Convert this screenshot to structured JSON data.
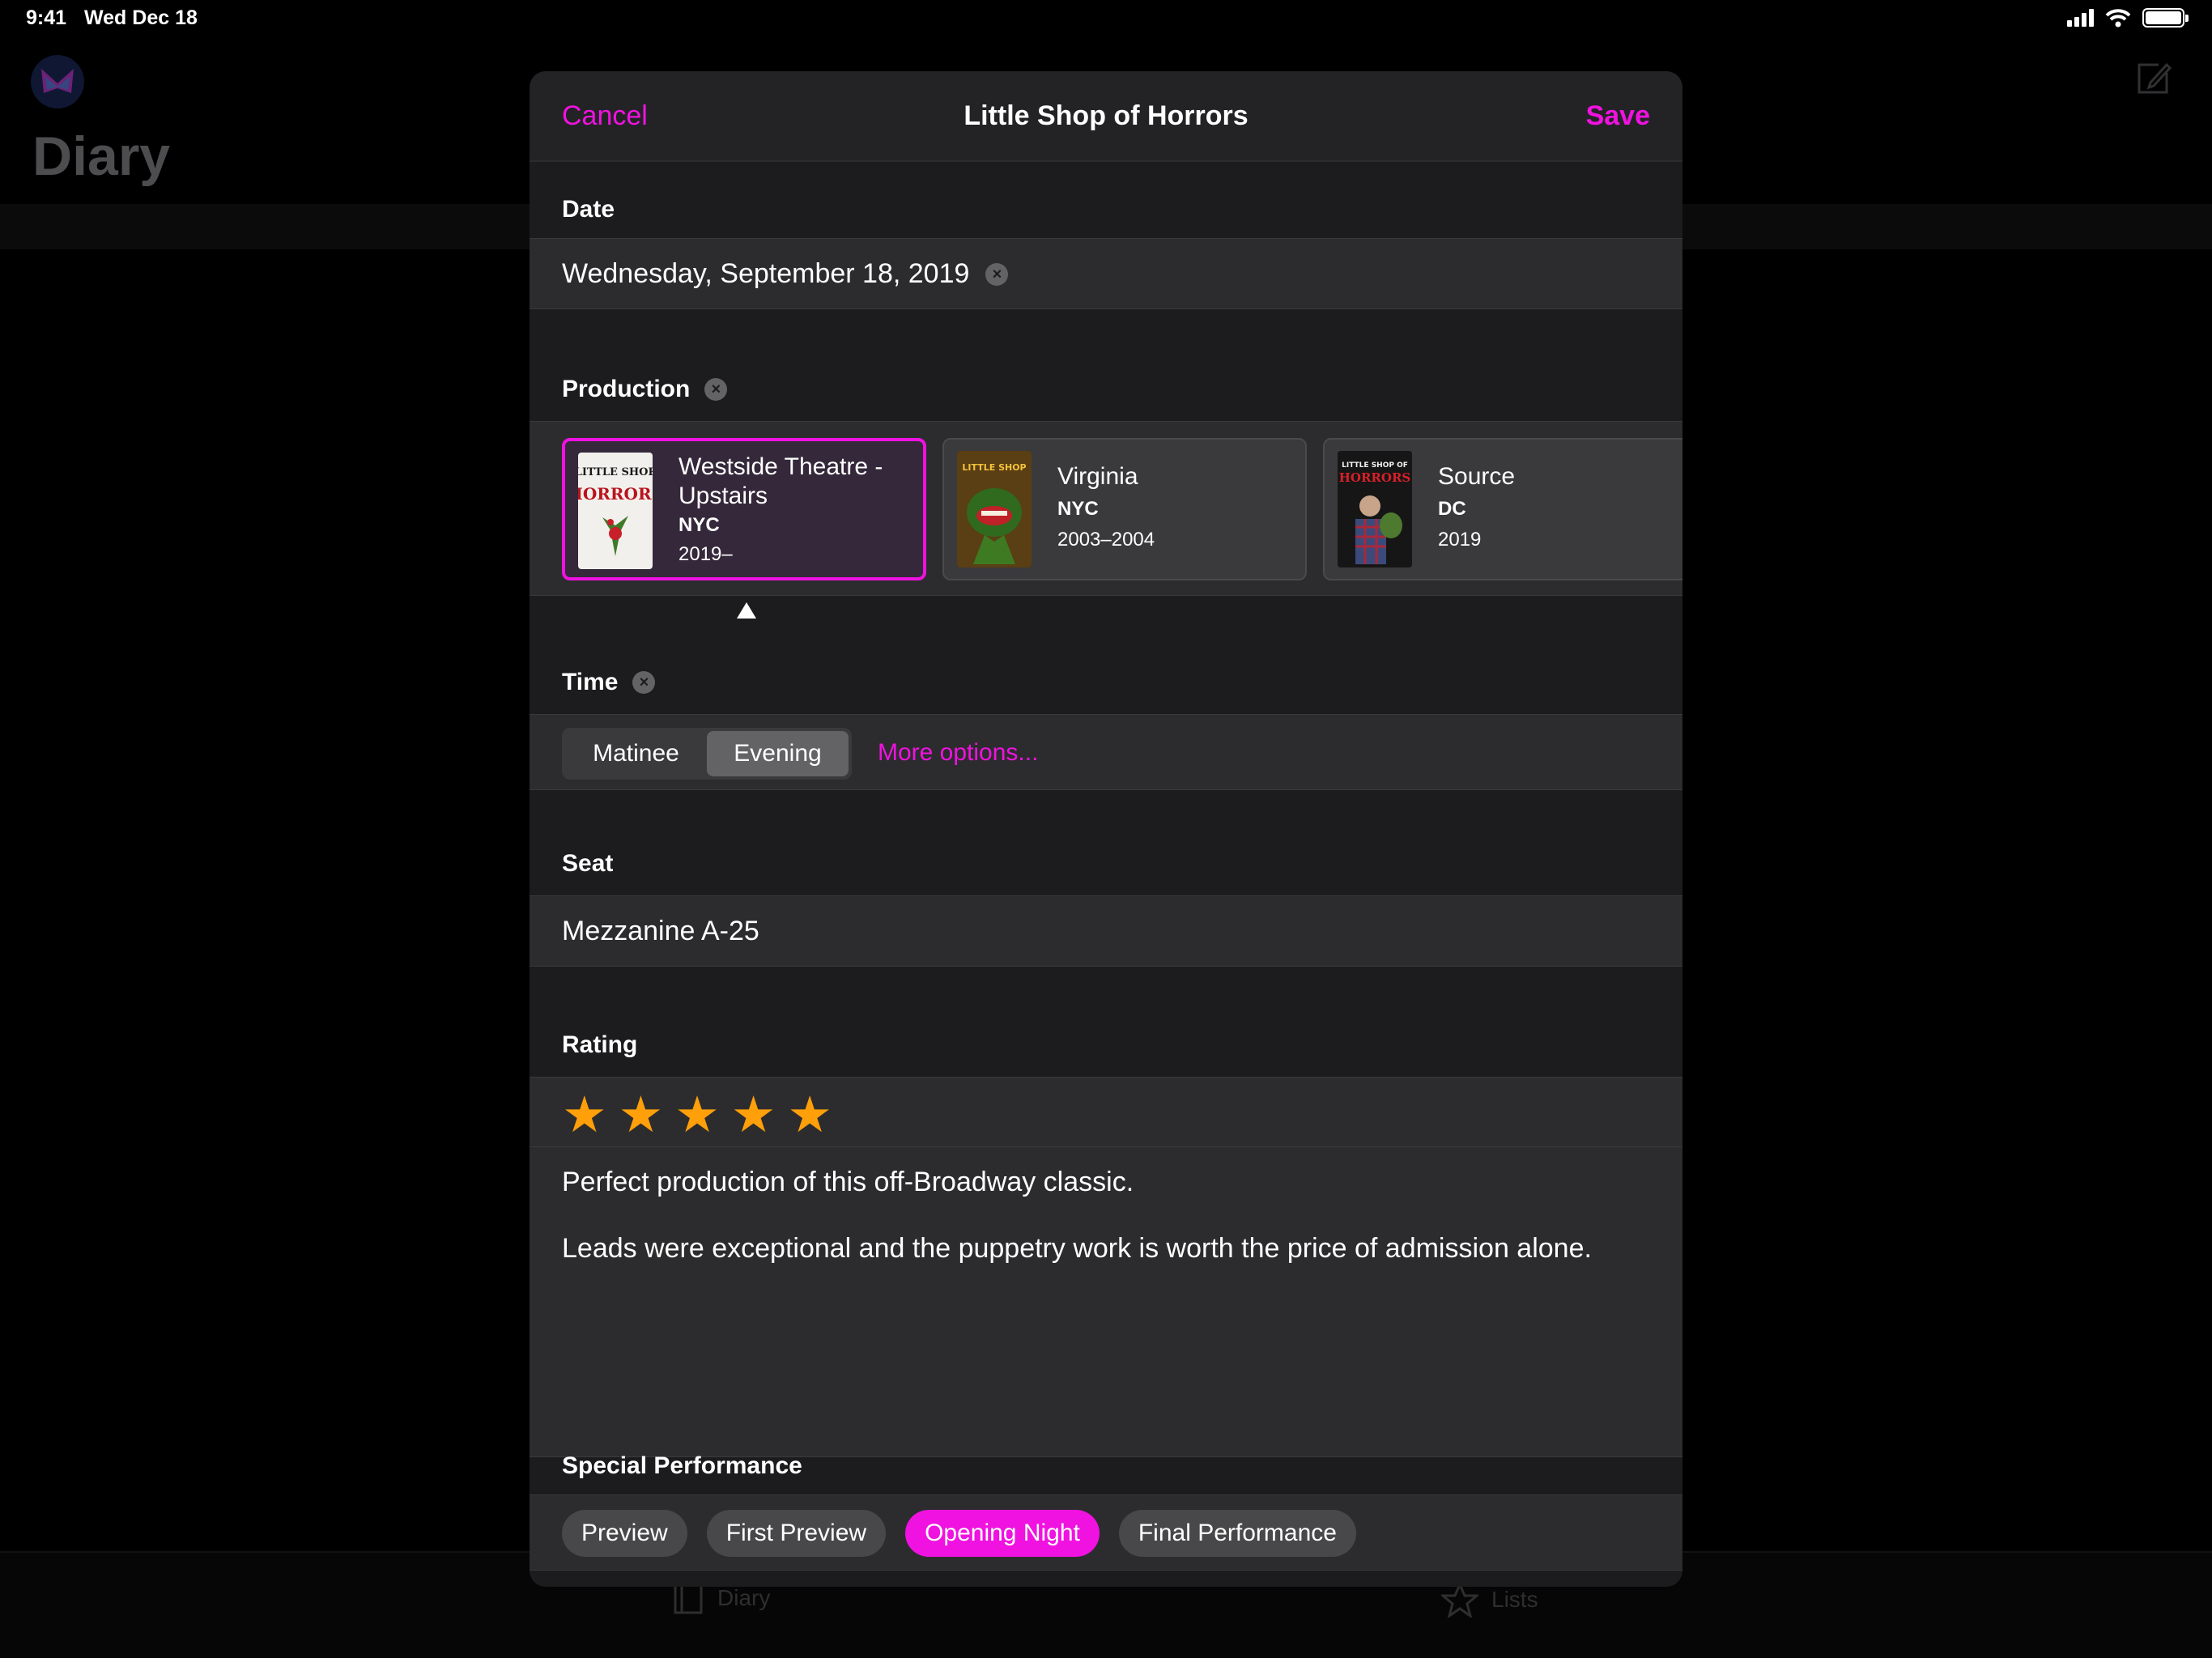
{
  "status_bar": {
    "time": "9:41",
    "date": "Wed Dec 18"
  },
  "background": {
    "page_title": "Diary",
    "tabs": [
      {
        "label": "Diary"
      },
      {
        "label": "Lists"
      }
    ]
  },
  "modal": {
    "nav": {
      "cancel": "Cancel",
      "title": "Little Shop of Horrors",
      "save": "Save"
    },
    "date": {
      "label": "Date",
      "value": "Wednesday, September 18, 2019"
    },
    "production": {
      "label": "Production",
      "cards": [
        {
          "name": "Westside Theatre - Upstairs",
          "city": "NYC",
          "years": "2019–",
          "selected": true
        },
        {
          "name": "Virginia",
          "city": "NYC",
          "years": "2003–2004",
          "selected": false
        },
        {
          "name": "Source",
          "city": "DC",
          "years": "2019",
          "selected": false
        }
      ]
    },
    "time": {
      "label": "Time",
      "options": [
        "Matinee",
        "Evening"
      ],
      "selected": "Evening",
      "more": "More options..."
    },
    "seat": {
      "label": "Seat",
      "value": "Mezzanine A-25"
    },
    "rating": {
      "label": "Rating",
      "stars": 5,
      "notes": [
        "Perfect production of this off-Broadway classic.",
        "Leads were exceptional and the puppetry work is worth the price of admission alone."
      ]
    },
    "special": {
      "label": "Special Performance",
      "options": [
        "Preview",
        "First Preview",
        "Opening Night",
        "Final Performance"
      ],
      "selected": "Opening Night"
    }
  },
  "colors": {
    "accent": "#f012e0",
    "star": "#ff9f0a",
    "sheet": "#1c1c1e",
    "row": "#2c2c2e"
  },
  "poster_text": {
    "p1_line1": "LITTLE SHOP",
    "p1_line2": "HORRORS",
    "p2_line1": "LITTLE SHOP",
    "p3_line1": "LITTLE SHOP OF",
    "p3_line2": "HORRORS"
  }
}
